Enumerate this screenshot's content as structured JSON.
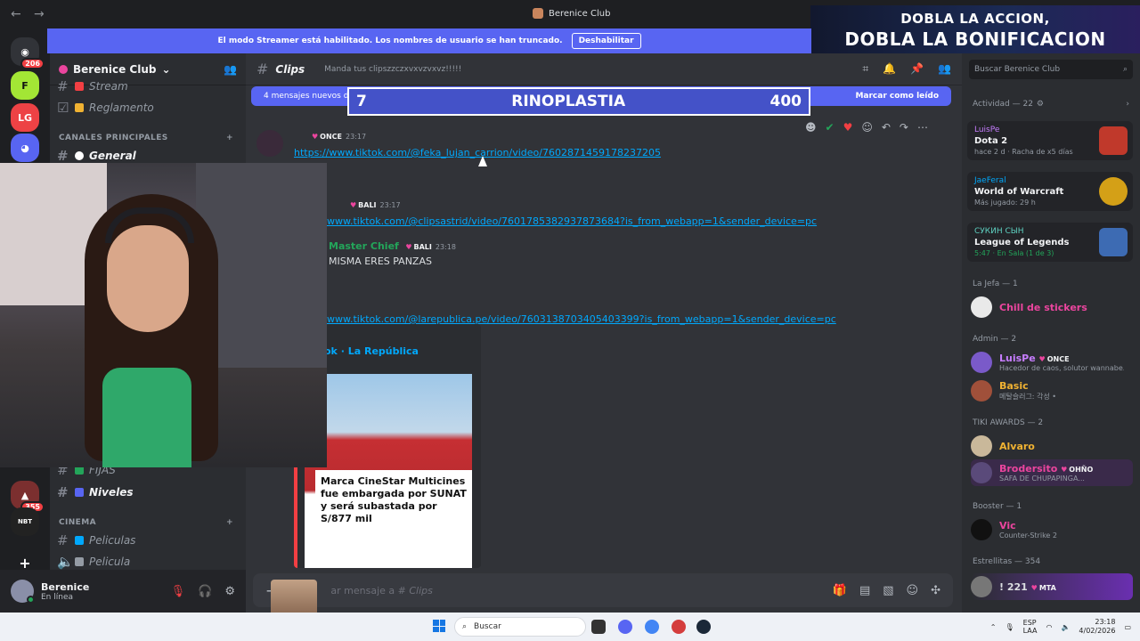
{
  "window": {
    "title": "Berenice Club"
  },
  "stream_overlay": {
    "line1": "DOBLA LA ACCION,",
    "line2": "DOBLA LA BONIFICACION"
  },
  "guilds": [
    {
      "badge": "206",
      "color": "#5865f2"
    },
    {
      "badge": "",
      "color": "#3ba55d"
    },
    {
      "badge": "",
      "color": "#ed4245"
    },
    {
      "badge": "",
      "color": "#5865f2"
    },
    {
      "badge": "355",
      "color": "#7b2f2f"
    },
    {
      "badge": "",
      "color": "#222"
    }
  ],
  "streamer_banner": {
    "text": "El modo Streamer está habilitado. Los nombres de usuario se han truncado.",
    "button": "Deshabilitar"
  },
  "server": {
    "name": "Berenice Club"
  },
  "channels": {
    "top": [
      {
        "name": "Stream",
        "icon_color": "#f23f43"
      },
      {
        "name": "Reglamento",
        "icon_color": "#f0b232"
      }
    ],
    "category_main": "CANALES PRINCIPALES",
    "general": "General",
    "bottom": [
      {
        "name": "FIJAS",
        "icon_color": "#23a55a"
      },
      {
        "name": "Niveles",
        "icon_color": "#5865f2"
      }
    ],
    "category_cinema": "CINEMA",
    "cinema": [
      {
        "name": "Peliculas",
        "icon_color": "#00a8fc"
      },
      {
        "name": "Pelicula",
        "icon_color": "#949ba4"
      }
    ]
  },
  "user": {
    "name": "Berenice",
    "status": "En línea"
  },
  "channel_header": {
    "name": "Clips",
    "topic": "Manda tus clipszzczxvxvzvxvz!!!!!"
  },
  "new_messages": {
    "text": "4 mensajes nuevos desde las 23:17",
    "mark": "Marcar como leído"
  },
  "poll_overlay": {
    "left": "7",
    "question": "RINOPLASTIA",
    "right": "400"
  },
  "messages": [
    {
      "tag": "ONCE",
      "time": "23:17",
      "link": "https://www.tiktok.com/@feka_lujan_carrion/video/7602871459178237205"
    },
    {
      "tag": "BALI",
      "time": "23:17",
      "link": "www.tiktok.com/@clipsastrid/video/7601785382937873684?is_from_webapp=1&sender_device=pc"
    },
    {
      "author": "Master Chief",
      "tag": "BALI",
      "time": "23:18",
      "text": "MISMA ERES PANZAS",
      "link": "www.tiktok.com/@larepublica.pe/video/7603138703405403399?is_from_webapp=1&sender_device=pc"
    }
  ],
  "embed": {
    "provider": "ok · La República",
    "caption": "Marca CineStar Multicines fue embargada por SUNAT y será subastada por S/877 mil"
  },
  "composer": {
    "placeholder": "ar mensaje a #",
    "channel": "Clips"
  },
  "members": {
    "search_placeholder": "Buscar Berenice Club",
    "activity_header": "Actividad — 22",
    "activities": [
      {
        "user": "LuisPe",
        "game": "Dota 2",
        "detail": "hace 2 d · Racha de x5 días",
        "color": "#c0392b"
      },
      {
        "user": "JaeFeral",
        "game": "World of Warcraft",
        "detail": "Más jugado: 29 h",
        "color": "#d4a017"
      },
      {
        "user": "CУКИН CЫH",
        "game": "League of Legends",
        "detail": "5:47 · En Sala (1 de 3)",
        "color": "#3d6bb3"
      }
    ],
    "groups": [
      {
        "header": "La Jefa — 1",
        "members": [
          {
            "name": "Chill de stickers",
            "color": "#eb459e",
            "sub": ""
          }
        ]
      },
      {
        "header": "Admin — 2",
        "members": [
          {
            "name": "LuisPe",
            "color": "#c77dff",
            "tag": "ONCE",
            "sub": "Hacedor de caos, solutor wannabe..."
          },
          {
            "name": "Basic",
            "color": "#f0b232",
            "sub": "메탈슬러그: 각성 •"
          }
        ]
      },
      {
        "header": "TIKI AWARDS — 2",
        "members": [
          {
            "name": "Alvaro",
            "color": "#f0b232",
            "sub": ""
          },
          {
            "name": "Brodersito",
            "color": "#eb459e",
            "tag": "OHÑO",
            "sub": "SAFA DE CHUPAPINGA..."
          }
        ]
      },
      {
        "header": "Booster — 1",
        "members": [
          {
            "name": "Vic",
            "color": "#eb459e",
            "sub": "Counter-Strike 2"
          }
        ]
      },
      {
        "header": "Estrellitas — 354",
        "members": [
          {
            "name": "! 221",
            "color": "#dbdee1",
            "tag": "MTA",
            "sub": ""
          }
        ]
      }
    ]
  },
  "taskbar": {
    "search": "Buscar",
    "lang": "ESP\nLAA",
    "time": "23:18",
    "date": "4/02/2026"
  }
}
